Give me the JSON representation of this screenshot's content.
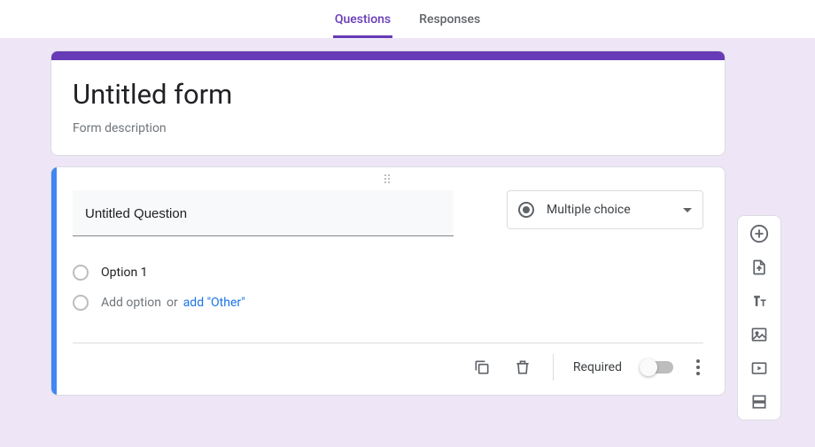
{
  "tabs": {
    "questions": "Questions",
    "responses": "Responses"
  },
  "header": {
    "title": "Untitled form",
    "description": "Form description"
  },
  "question": {
    "title": "Untitled Question",
    "type_label": "Multiple choice",
    "options": [
      {
        "label": "Option 1"
      }
    ],
    "add_option": "Add option",
    "or_text": "or",
    "add_other": "add \"Other\""
  },
  "footer": {
    "required_label": "Required"
  },
  "side_toolbar": {
    "add": "add-question",
    "import": "import-questions",
    "text": "add-title",
    "image": "add-image",
    "video": "add-video",
    "section": "add-section"
  }
}
